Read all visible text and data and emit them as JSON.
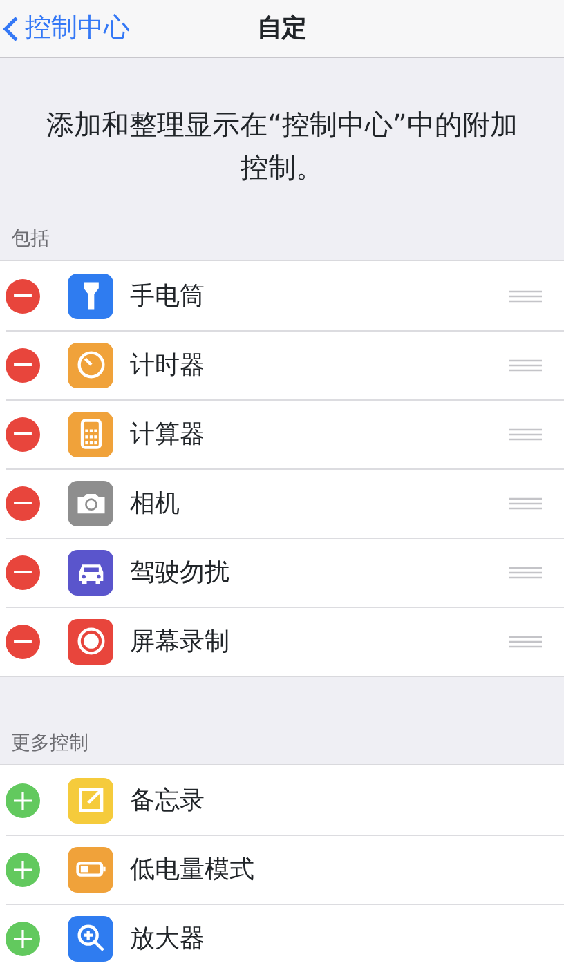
{
  "nav": {
    "back": "控制中心",
    "title": "自定"
  },
  "description": "添加和整理显示在“控制中心”中的附加控制。",
  "sections": [
    {
      "header": "包括",
      "kind": "remove",
      "items": [
        {
          "label": "手电筒",
          "color": "#2f7cf0"
        },
        {
          "label": "计时器",
          "color": "#f0a23a"
        },
        {
          "label": "计算器",
          "color": "#f0a23a"
        },
        {
          "label": "相机",
          "color": "#8e8e8e"
        },
        {
          "label": "驾驶勿扰",
          "color": "#5a55cc"
        },
        {
          "label": "屏幕录制",
          "color": "#e8453c"
        }
      ]
    },
    {
      "header": "更多控制",
      "kind": "add",
      "items": [
        {
          "label": "备忘录",
          "color": "#f5cb3c"
        },
        {
          "label": "低电量模式",
          "color": "#f0a23a"
        },
        {
          "label": "放大器",
          "color": "#2f7cf0"
        }
      ]
    }
  ]
}
